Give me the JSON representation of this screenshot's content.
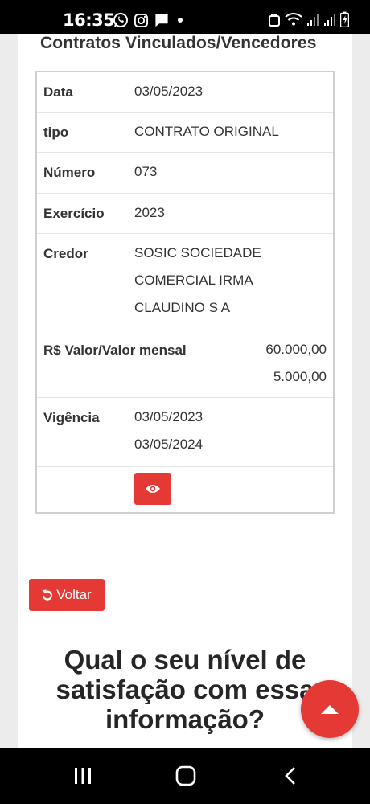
{
  "status_bar": {
    "time": "16:35",
    "left_icons": [
      "whatsapp-icon",
      "instagram-icon",
      "message-icon",
      "dot-icon"
    ],
    "right_icons": [
      "alarm-icon",
      "wifi-icon",
      "signal-icon",
      "signal-icon",
      "battery-icon"
    ]
  },
  "section": {
    "title": "Contratos Vinculados/Vencedores"
  },
  "table": {
    "rows": [
      {
        "label": "Data",
        "value": "03/05/2023"
      },
      {
        "label": "tipo",
        "value": "CONTRATO ORIGINAL"
      },
      {
        "label": "Número",
        "value": "073"
      },
      {
        "label": "Exercício",
        "value": "2023"
      },
      {
        "label": "Credor",
        "lines": [
          "SOSIC SOCIEDADE",
          "COMERCIAL IRMA",
          "CLAUDINO S A"
        ]
      },
      {
        "label": "R$ Valor/Valor mensal",
        "lines": [
          "60.000,00",
          "5.000,00"
        ]
      },
      {
        "label": "Vigência",
        "lines": [
          "03/05/2023",
          "03/05/2024"
        ]
      }
    ],
    "view_icon": "eye-icon"
  },
  "back_button": {
    "label": "Voltar",
    "icon": "undo-icon"
  },
  "survey": {
    "title_lines": [
      "Qual o seu nível de",
      "satisfação com essa",
      "informação?"
    ]
  },
  "fab": {
    "icon": "arrow-up-icon"
  },
  "nav_bar": {
    "icons": [
      "recent-apps-icon",
      "home-icon",
      "back-icon"
    ]
  },
  "colors": {
    "accent": "#e53935",
    "background": "#ececec",
    "card": "#ffffff",
    "text": "#333333"
  }
}
